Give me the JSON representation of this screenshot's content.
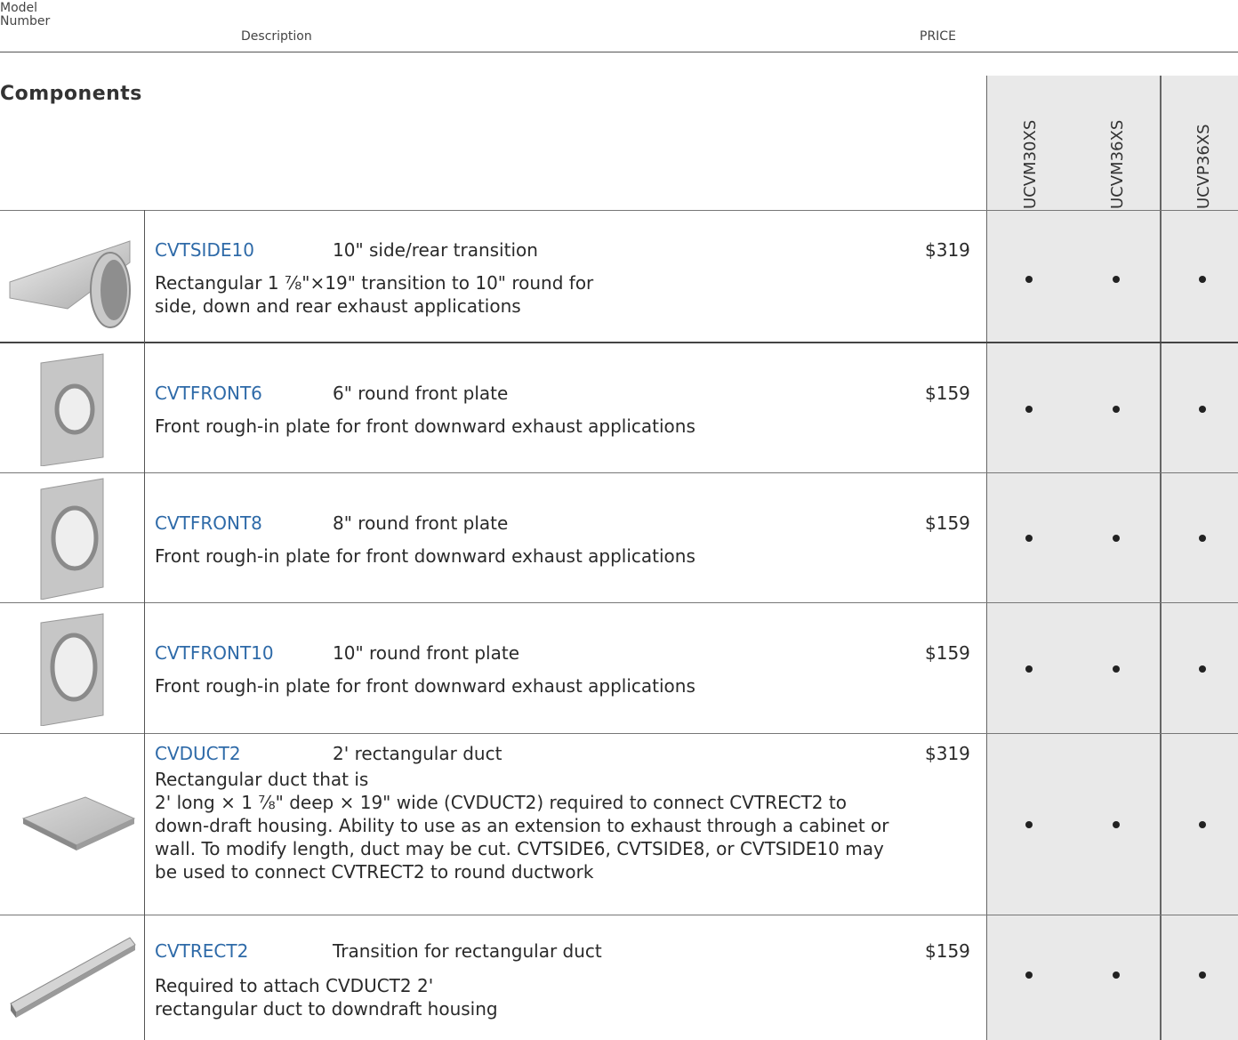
{
  "header": {
    "model_line1": "Model",
    "model_line2": "Number",
    "description": "Description",
    "price": "PRICE"
  },
  "section_title": "Components",
  "compatibility_columns": [
    "UCVM30XS",
    "UCVM36XS",
    "UCVP36XS"
  ],
  "rows": [
    {
      "model": "CVTSIDE10",
      "title": "10\" side/rear transition",
      "price": "$319",
      "desc": [
        "Rectangular 1 ⅞\"×19\" transition to 10\" round for",
        "side, down and rear exhaust applications"
      ],
      "compat": [
        "•",
        "•",
        "•"
      ],
      "image_icon": "side-transition-image"
    },
    {
      "model": "CVTFRONT6",
      "title": "6\" round front plate",
      "price": "$159",
      "desc": [
        "Front rough-in plate for front downward exhaust applications"
      ],
      "compat": [
        "•",
        "•",
        "•"
      ],
      "image_icon": "front-plate-image"
    },
    {
      "model": "CVTFRONT8",
      "title": "8\" round front plate",
      "price": "$159",
      "desc": [
        "Front rough-in plate for front downward exhaust applications"
      ],
      "compat": [
        "•",
        "•",
        "•"
      ],
      "image_icon": "front-plate-image"
    },
    {
      "model": "CVTFRONT10",
      "title": "10\" round front plate",
      "price": "$159",
      "desc": [
        "Front rough-in plate for front downward exhaust applications"
      ],
      "compat": [
        "•",
        "•",
        "•"
      ],
      "image_icon": "front-plate-image"
    },
    {
      "model": "CVDUCT2",
      "title": "2' rectangular duct",
      "price": "$319",
      "desc": [
        "Rectangular duct that is",
        "2' long × 1 ⅞\" deep × 19\" wide (CVDUCT2) required to connect CVTRECT2 to",
        "down-draft housing. Ability to use as an extension to exhaust through a cabinet or",
        "wall. To modify length, duct may be cut. CVTSIDE6, CVTSIDE8, or CVTSIDE10 may",
        "be used to connect CVTRECT2 to round ductwork"
      ],
      "compat": [
        "•",
        "•",
        "•"
      ],
      "image_icon": "rectangular-duct-image"
    },
    {
      "model": "CVTRECT2",
      "title": "Transition for rectangular duct",
      "price": "$159",
      "desc": [
        "Required to attach CVDUCT2 2'",
        "rectangular duct to downdraft housing"
      ],
      "compat": [
        "•",
        "•",
        "•"
      ],
      "image_icon": "rect-transition-image"
    }
  ],
  "colors": {
    "model_link": "#2e6aa8",
    "compat_column_bg": "#e9e9e9"
  }
}
